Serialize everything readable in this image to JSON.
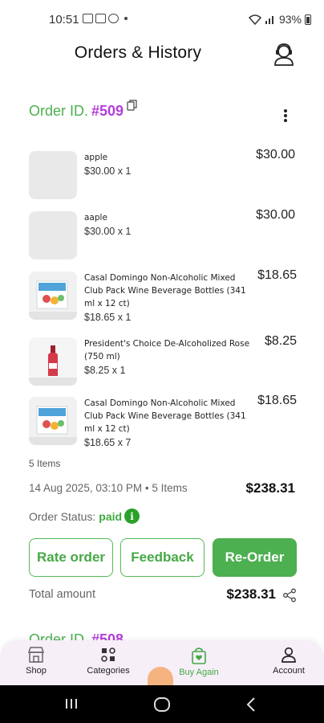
{
  "status_bar": {
    "time": "10:51",
    "battery": "93%"
  },
  "header": {
    "title": "Orders & History"
  },
  "order": {
    "id_label": "Order ID.",
    "id_number": "#509",
    "items": [
      {
        "name": "apple",
        "qty": "$30.00 x 1",
        "price": "$30.00",
        "has_image": false
      },
      {
        "name": "aaple",
        "qty": "$30.00 x 1",
        "price": "$30.00",
        "has_image": false
      },
      {
        "name": "Casal Domingo Non-Alcoholic Mixed Club Pack Wine Beverage Bottles (341 ml x 12 ct)",
        "qty": "$18.65 x 1",
        "price": "$18.65",
        "has_image": true
      },
      {
        "name": "President's Choice De-Alcoholized Rose (750 ml)",
        "qty": "$8.25 x 1",
        "price": "$8.25",
        "has_image": true
      },
      {
        "name": "Casal Domingo Non-Alcoholic Mixed Club Pack Wine Beverage Bottles (341 ml x 12 ct)",
        "qty": "$18.65 x 7",
        "price": "$18.65",
        "has_image": true
      }
    ],
    "items_count": "5 Items",
    "meta": "14 Aug 2025, 03:10 PM • 5 Items",
    "total_top": "$238.31",
    "status_label": "Order Status:",
    "status_value": "paid",
    "actions": {
      "rate": "Rate order",
      "feedback": "Feedback",
      "reorder": "Re-Order"
    },
    "total_label": "Total amount",
    "total_value": "$238.31"
  },
  "next_order": {
    "id_label": "Order ID.",
    "id_number": "#508"
  },
  "bottom_nav": {
    "shop": "Shop",
    "categories": "Categories",
    "buy_again": "Buy Again",
    "account": "Account"
  },
  "colors": {
    "accent_green": "#4caf50",
    "order_purple": "#b23fd6",
    "nav_bg": "#f6eff8"
  }
}
